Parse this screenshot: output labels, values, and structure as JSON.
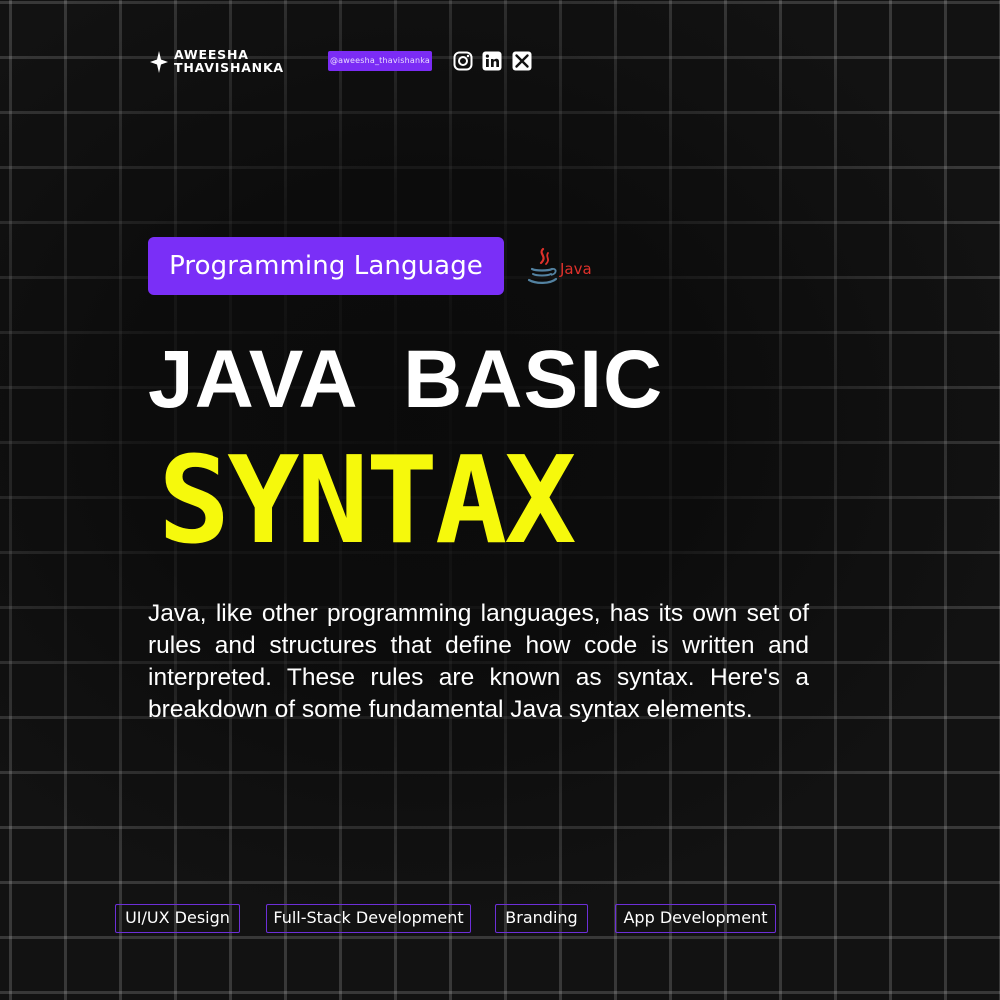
{
  "header": {
    "brand_line_1": "AWEESHA",
    "brand_line_2": "THAVISHANKA",
    "handle": "@aweesha_thavishanka",
    "social_icons": [
      "instagram-icon",
      "linkedin-icon",
      "x-icon"
    ]
  },
  "main": {
    "tag": "Programming Language",
    "logo_text": "Java",
    "title_line_1": "JAVA  BASIC",
    "title_line_2": "SYNTAX",
    "description": "Java, like other programming languages, has its own set of rules and structures that define how code is written and interpreted. These rules are known as syntax. Here's a breakdown of some fundamental Java syntax elements."
  },
  "footer": {
    "chips": [
      "UI/UX Design",
      "Full-Stack Development",
      "Branding",
      "App Development"
    ]
  },
  "colors": {
    "background": "#121212",
    "accent_purple": "#7a2ff7",
    "title_yellow": "#f6f90c",
    "java_red": "#e0312b",
    "java_blue": "#5382a1"
  }
}
